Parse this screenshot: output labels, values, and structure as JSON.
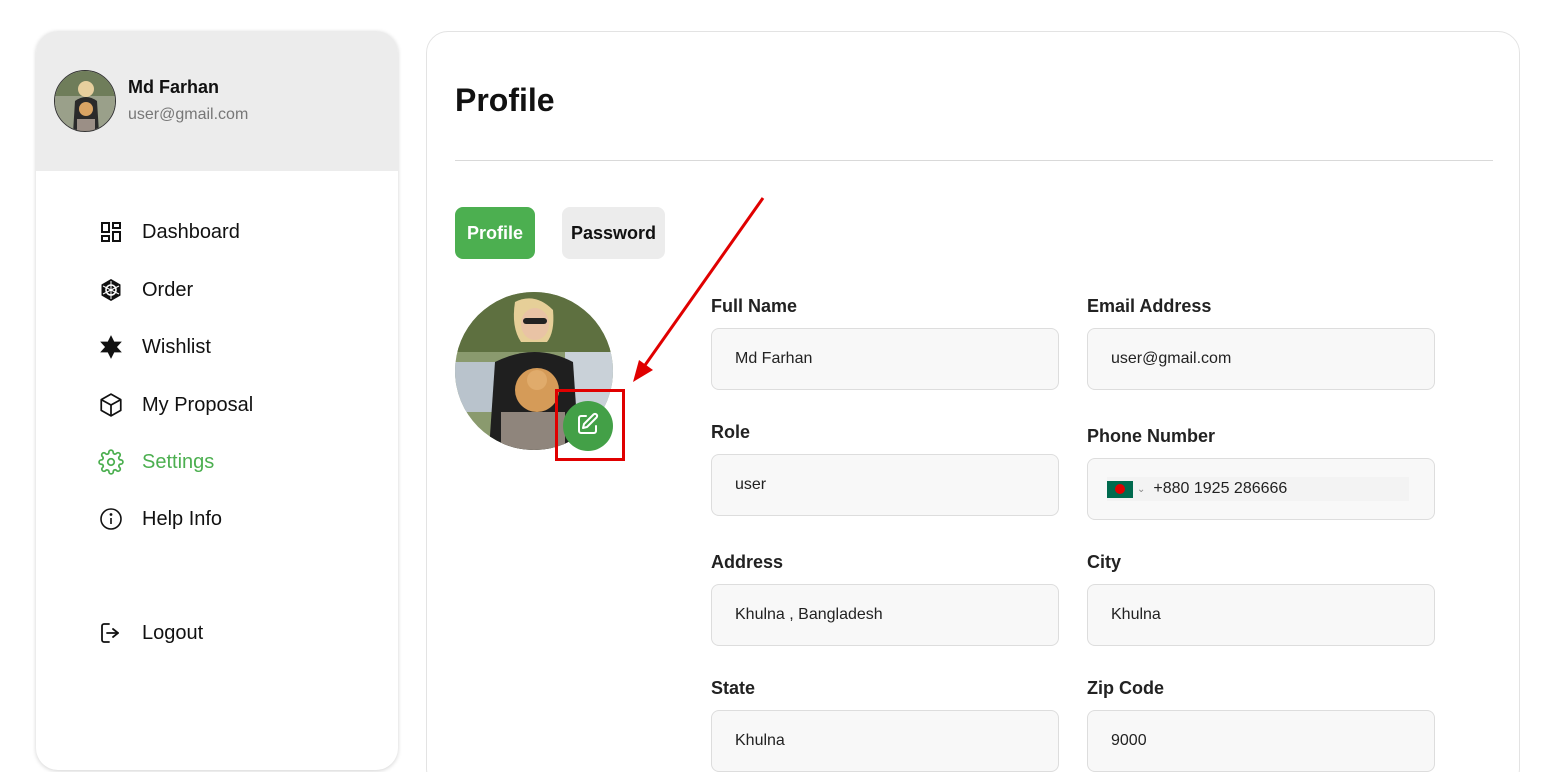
{
  "user": {
    "name": "Md Farhan",
    "email": "user@gmail.com"
  },
  "nav": [
    {
      "label": "Dashboard",
      "icon": "dashboard-icon"
    },
    {
      "label": "Order",
      "icon": "order-icon"
    },
    {
      "label": "Wishlist",
      "icon": "star-icon"
    },
    {
      "label": "My Proposal",
      "icon": "box-icon"
    },
    {
      "label": "Settings",
      "icon": "gear-icon",
      "active": true
    },
    {
      "label": "Help Info",
      "icon": "info-icon"
    }
  ],
  "logout": {
    "label": "Logout",
    "icon": "logout-icon"
  },
  "page": {
    "title": "Profile"
  },
  "tabs": {
    "profile": "Profile",
    "password": "Password"
  },
  "form": {
    "full_name": {
      "label": "Full Name",
      "value": "Md Farhan"
    },
    "email": {
      "label": "Email Address",
      "value": "user@gmail.com"
    },
    "role": {
      "label": "Role",
      "value": "user"
    },
    "phone": {
      "label": "Phone Number",
      "value": "+880 1925 286666",
      "country_flag": "bangladesh-flag-icon"
    },
    "address": {
      "label": "Address",
      "value": "Khulna , Bangladesh"
    },
    "city": {
      "label": "City",
      "value": "Khulna"
    },
    "state": {
      "label": "State",
      "value": "Khulna"
    },
    "zip": {
      "label": "Zip Code",
      "value": "9000"
    }
  },
  "colors": {
    "accent": "#4caf50",
    "annotation": "#e00000"
  }
}
